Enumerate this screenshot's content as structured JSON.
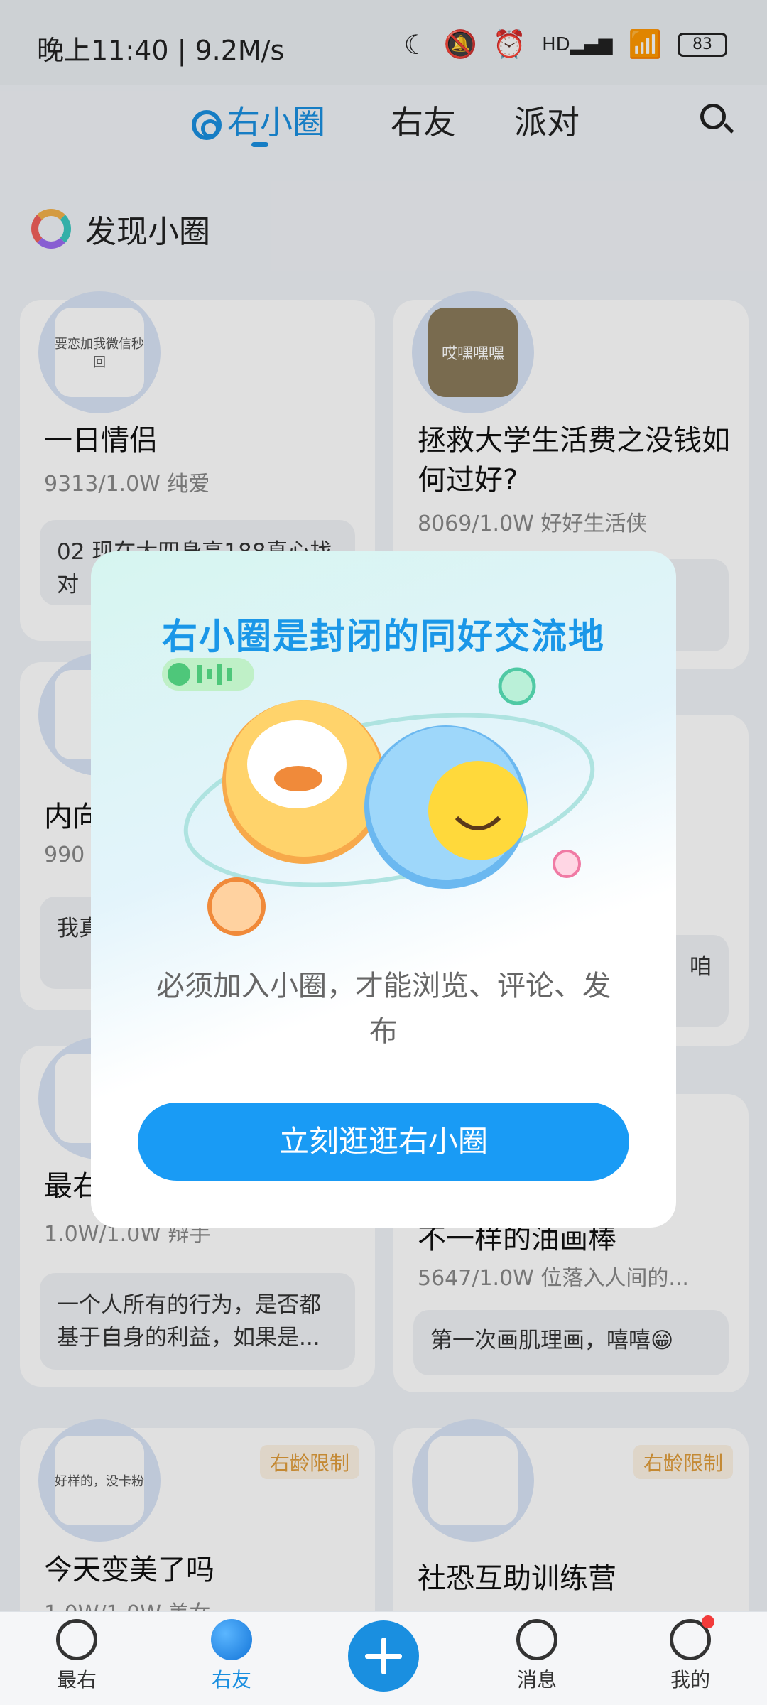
{
  "status_bar": {
    "time_speed": "晚上11:40 | 9.2M/s",
    "network": "HD",
    "battery": "83"
  },
  "top_nav": {
    "tabs": [
      {
        "label": "右小圈",
        "active": true
      },
      {
        "label": "右友",
        "active": false
      },
      {
        "label": "派对",
        "active": false
      }
    ]
  },
  "section": {
    "title": "发现小圈"
  },
  "cards": [
    {
      "title": "一日情侣",
      "meta": "9313/1.0W 纯爱",
      "preview": "02 现在大四身高188真心找对",
      "avatar_caption": "要恋加我微信秒回"
    },
    {
      "title": "拯救大学生活费之没钱如何过好?",
      "meta": "8069/1.0W 好好生活侠",
      "preview": "",
      "avatar_caption": "哎嘿嘿嘿"
    },
    {
      "title": "内向",
      "meta": "990",
      "preview": "我真笨,",
      "avatar_caption": ""
    },
    {
      "title": "",
      "meta": "",
      "preview": "咱",
      "avatar_caption": ""
    },
    {
      "title": "最右",
      "meta": "1.0W/1.0W 辩手",
      "preview": "一个人所有的行为，是否都基于自身的利益，如果是...",
      "avatar_caption": ""
    },
    {
      "title": "不一样的油画棒",
      "meta": "5647/1.0W 位落入人间的...",
      "preview": "第一次画肌理画，嘻嘻😁",
      "avatar_caption": ""
    },
    {
      "title": "今天变美了吗",
      "meta": "1.0W/1.0W 美女",
      "badge": "右龄限制",
      "avatar_caption": "好样的，没卡粉"
    },
    {
      "title": "社恐互助训练营",
      "meta": "",
      "badge": "右龄限制",
      "avatar_caption": ""
    }
  ],
  "dialog": {
    "title": "右小圈是封闭的同好交流地",
    "description": "必须加入小圈，才能浏览、评论、发布",
    "cta": "立刻逛逛右小圈"
  },
  "bottom_nav": {
    "items": [
      {
        "label": "最右",
        "icon": "smile-face-icon"
      },
      {
        "label": "右友",
        "icon": "planet-icon",
        "active": true
      },
      {
        "label": "",
        "icon": "add-icon"
      },
      {
        "label": "消息",
        "icon": "message-icon"
      },
      {
        "label": "我的",
        "icon": "profile-icon"
      }
    ]
  },
  "colors": {
    "accent": "#1a8fe0",
    "cta": "#199bf5",
    "badge": "#e09c3b"
  }
}
